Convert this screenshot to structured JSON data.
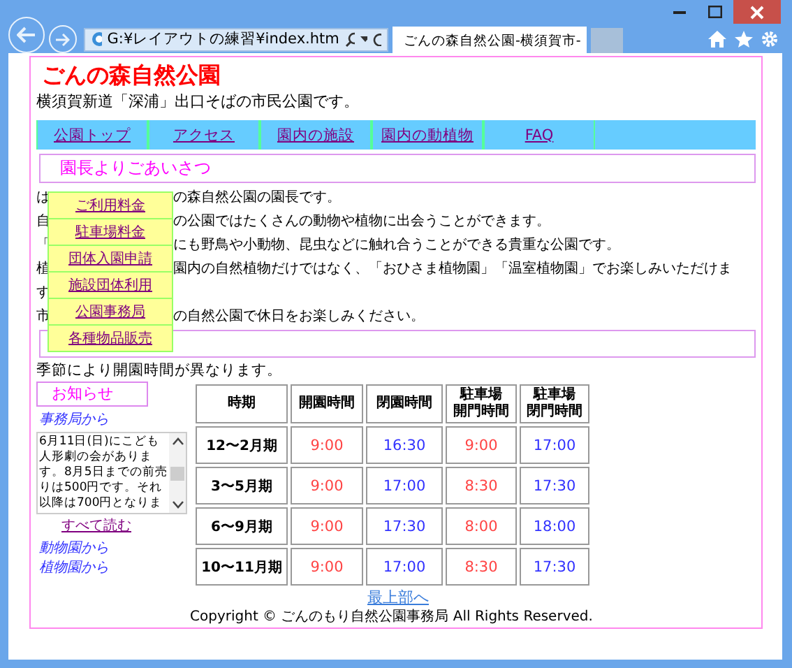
{
  "browser": {
    "address": "G:¥レイアウトの練習¥index.htm",
    "tab_title": "ごんの森自然公園-横須賀市-"
  },
  "page": {
    "title": "ごんの森自然公園",
    "subtitle": "横須賀新道「深浦」出口そばの市民公園です。",
    "nav": [
      {
        "label": "公園トップ"
      },
      {
        "label": "アクセス"
      },
      {
        "label": "園内の施設"
      },
      {
        "label": "園内の動植物"
      },
      {
        "label": "FAQ"
      }
    ],
    "greeting_heading": "園長よりごあいさつ",
    "greeting_lines": [
      {
        "lead": "は",
        "text": "の森自然公園の園長です。"
      },
      {
        "lead": "自",
        "text": "の公園ではたくさんの動物や植物に出会うことができます。"
      },
      {
        "lead": "「",
        "text": "にも野鳥や小動物、昆虫などに触れ合うことができる貴重な公園です。"
      },
      {
        "lead": "植",
        "text": "園内の自然植物だけではなく、「おひさま植物園」「温室植物園」でお楽しみいただけま"
      },
      {
        "lead": "す"
      },
      {
        "lead": "市",
        "text": "の自然公園で休日をお楽しみください。"
      }
    ],
    "menu": [
      {
        "label": "ご利用料金"
      },
      {
        "label": "駐車場料金"
      },
      {
        "label": "団体入園申請"
      },
      {
        "label": "施設団体利用"
      },
      {
        "label": "公園事務局"
      },
      {
        "label": "各種物品販売"
      }
    ],
    "hours_note": "季節により開園時間が異なります。",
    "table": {
      "columns": [
        "時期",
        "開園時間",
        "閉園時間",
        "駐車場開門時間",
        "駐車場閉門時間"
      ],
      "rows": [
        [
          "12〜2月期",
          "9:00",
          "16:30",
          "9:00",
          "17:00"
        ],
        [
          "3〜5月期",
          "9:00",
          "17:00",
          "8:30",
          "17:30"
        ],
        [
          "6〜9月期",
          "9:00",
          "17:30",
          "8:00",
          "18:00"
        ],
        [
          "10〜11月期",
          "9:00",
          "17:00",
          "8:30",
          "17:30"
        ]
      ]
    },
    "news": {
      "heading": "お知らせ",
      "source": "事務局から",
      "body": "6月11日(日)にこども人形劇の会があります。8月5日までの前売りは500円です。それ以降は700円となりま",
      "more": "すべて読む",
      "links": [
        "動物園から",
        "植物園から"
      ]
    },
    "top_link": "最上部へ",
    "copyright": "Copyright © ごんのもり自然公園事務局 All Rights Reserved."
  }
}
